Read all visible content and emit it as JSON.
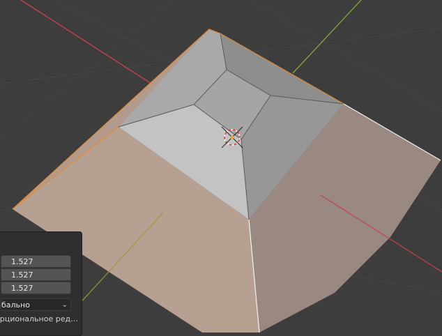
{
  "operator_panel": {
    "scale": [
      "1.527",
      "1.527",
      "1.527"
    ],
    "orientation_value": "бально",
    "proportional_editing_label": "орциональное ред…"
  },
  "viewport": {
    "background": "#3d3d3d",
    "axis_x_color": "#c4434d",
    "axis_y_color": "#7ea43a",
    "selected_face_color": "#b39d8f",
    "selection_edge_color": "#e08a3c"
  }
}
